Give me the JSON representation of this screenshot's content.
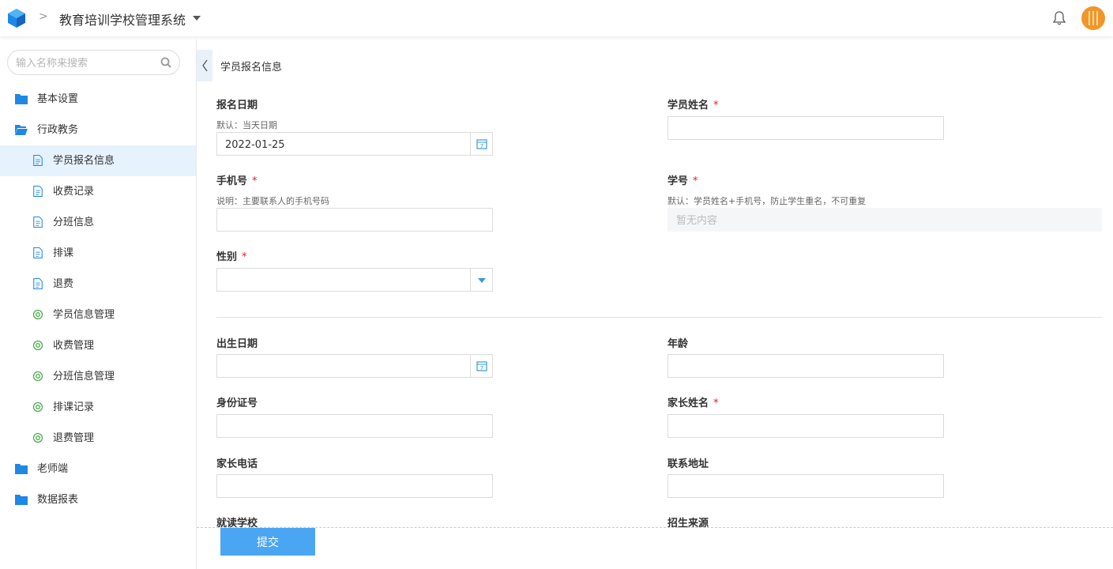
{
  "app": {
    "title": "教育培训学校管理系统"
  },
  "sidebar": {
    "search_placeholder": "输入名称来搜索",
    "items": [
      {
        "label": "基本设置",
        "icon": "folder-icon"
      },
      {
        "label": "行政教务",
        "icon": "folder-open-icon"
      },
      {
        "label": "学员报名信息",
        "icon": "document-icon",
        "active": true
      },
      {
        "label": "收费记录",
        "icon": "document-icon"
      },
      {
        "label": "分班信息",
        "icon": "document-icon"
      },
      {
        "label": "排课",
        "icon": "document-icon"
      },
      {
        "label": "退费",
        "icon": "document-icon"
      },
      {
        "label": "学员信息管理",
        "icon": "target-icon"
      },
      {
        "label": "收费管理",
        "icon": "target-icon"
      },
      {
        "label": "分班信息管理",
        "icon": "target-icon"
      },
      {
        "label": "排课记录",
        "icon": "target-icon"
      },
      {
        "label": "退费管理",
        "icon": "target-icon"
      },
      {
        "label": "老师端",
        "icon": "folder-icon"
      },
      {
        "label": "数据报表",
        "icon": "folder-icon"
      }
    ]
  },
  "form": {
    "title": "学员报名信息",
    "enroll_date": {
      "label": "报名日期",
      "hint": "默认：当天日期",
      "value": "2022-01-25"
    },
    "student_name": {
      "label": "学员姓名",
      "required": "*"
    },
    "phone": {
      "label": "手机号",
      "required": "*",
      "hint": "说明：主要联系人的手机号码"
    },
    "student_no": {
      "label": "学号",
      "required": "*",
      "hint": "默认：学员姓名+手机号，防止学生重名，不可重复",
      "placeholder": "暂无内容"
    },
    "gender": {
      "label": "性别",
      "required": "*"
    },
    "birth_date": {
      "label": "出生日期"
    },
    "age": {
      "label": "年龄"
    },
    "id_number": {
      "label": "身份证号"
    },
    "parent_name": {
      "label": "家长姓名",
      "required": "*"
    },
    "parent_phone": {
      "label": "家长电话"
    },
    "address": {
      "label": "联系地址"
    },
    "school": {
      "label": "就读学校"
    },
    "source": {
      "label": "招生来源"
    },
    "submit_label": "提交"
  },
  "colors": {
    "accent": "#4aa6f3",
    "active_bg": "#e6f2fc",
    "folder": "#1e88e5",
    "target": "#4caf50",
    "required": "#e02020"
  }
}
